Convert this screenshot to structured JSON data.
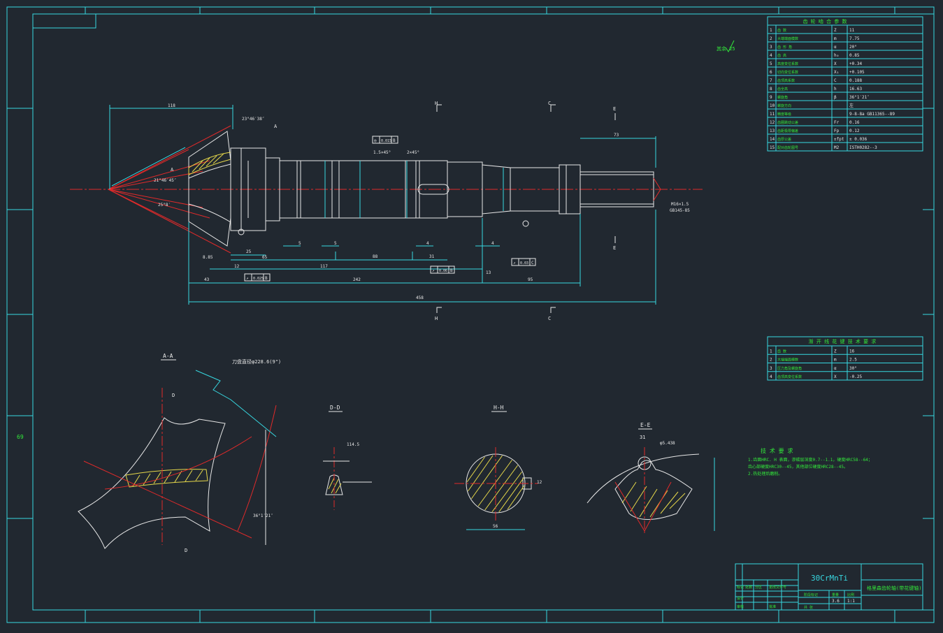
{
  "sheet": {
    "left_margin_number": "69"
  },
  "material": "30CrMnTi",
  "title_block": {
    "drawing_title": "格里森齿轮轴(带花键轴)",
    "cells": [
      "标记",
      "处数",
      "分区",
      "更改文件号",
      "签名",
      "年月日",
      "设计",
      "标准化",
      "审核",
      "工艺",
      "批准",
      "阶段标记",
      "重量",
      "比例",
      "共",
      "张",
      "第",
      "张"
    ],
    "scale": "1:1",
    "weight": "3.6",
    "sheets": "共 张"
  },
  "param_table": {
    "title": "齿 轮 啮 合 参 数",
    "rows": [
      {
        "no": "1",
        "name": "齿 数",
        "sym": "Z",
        "val": "11"
      },
      {
        "no": "2",
        "name": "大端端面模数",
        "sym": "m",
        "val": "7.75"
      },
      {
        "no": "3",
        "name": "齿 形 角",
        "sym": "α",
        "val": "20°"
      },
      {
        "no": "4",
        "name": "齿 高",
        "sym": "h₀",
        "val": "0.85"
      },
      {
        "no": "5",
        "name": "高度变位系数",
        "sym": "X",
        "val": "+0.34"
      },
      {
        "no": "6",
        "name": "切向变位系数",
        "sym": "X₁",
        "val": "+0.105"
      },
      {
        "no": "7",
        "name": "齿顶高系数",
        "sym": "C",
        "val": "0.188"
      },
      {
        "no": "8",
        "name": "齿全高",
        "sym": "h",
        "val": "16.63"
      },
      {
        "no": "9",
        "name": "螺旋角",
        "sym": "β",
        "val": "36°1′21″"
      },
      {
        "no": "10",
        "name": "螺旋方向",
        "sym": "",
        "val": "左"
      },
      {
        "no": "11",
        "name": "精度等级",
        "sym": "",
        "val": "9-8-8a GB11365--89"
      },
      {
        "no": "12",
        "name": "齿圈跳动公差",
        "sym": "Fr",
        "val": "0.16"
      },
      {
        "no": "13",
        "name": "齿距极限偏差",
        "sym": "Fp",
        "val": "0.12"
      },
      {
        "no": "14",
        "name": "齿厚公差",
        "sym": "±fpt",
        "val": "± 0.036"
      },
      {
        "no": "15",
        "name": "配对齿轮图号",
        "sym": "M2",
        "val": "ISTH0282--3"
      }
    ]
  },
  "spline_table": {
    "title": "渐 开 线 花 键 技 术 要 求",
    "rows": [
      {
        "no": "1",
        "name": "齿 数",
        "sym": "Z",
        "val": "16"
      },
      {
        "no": "2",
        "name": "大端端面模数",
        "sym": "m",
        "val": "2.5"
      },
      {
        "no": "3",
        "name": "压力角及螺旋角",
        "sym": "α",
        "val": "30°"
      },
      {
        "no": "4",
        "name": "齿顶高变位系数",
        "sym": "X",
        "val": "-0.25"
      }
    ]
  },
  "technical_requirements": {
    "title": "技 术 要 求",
    "lines": [
      "1.齿面HRC. H 表面，渗碳层深度0.7--1.1，硬度HRC58--64；",
      "   齿心部硬度HRC30--45，其他部位硬度HRC28--45。",
      "2.热处理后磨削。"
    ]
  },
  "roughness_note": "其余 25",
  "section_labels": {
    "aa": "A-A",
    "dd": "D-D",
    "hh": "H-H",
    "ee": "E-E",
    "h_top": "H",
    "h_bot": "H",
    "c_top": "C",
    "c_bot": "C",
    "e_top": "E",
    "e_bot": "E",
    "a1": "A",
    "a2": "A",
    "d_top": "D",
    "d_bot": "D"
  },
  "dimensions": {
    "d118": "118",
    "d73": "73",
    "d25": "25",
    "d65": "65",
    "d5a": "5",
    "d5b": "5",
    "d4a": "4",
    "d4b": "4",
    "d31": "31",
    "d88": "88",
    "d117": "117",
    "d43": "43",
    "d242": "242",
    "d95": "95",
    "d13": "13",
    "d12": "12",
    "d458": "458",
    "d885": "8.85",
    "total": "458",
    "m16": "M16×1.5",
    "gb": "GB145-85",
    "cham1": "2×45°",
    "cham2": "1.5×45°",
    "cut_dia": "刀盘直径φ228.6(9\")",
    "ang": "36°1′21″",
    "ang2": "23°46′38″",
    "ang3": "21°46′45″",
    "ang4": "25°8′",
    "d56": "56",
    "ee_31": "31",
    "ee_phi": "φ5.438",
    "dd_dim": "114.5",
    "hh_key": "12"
  },
  "tolerance_frames": [
    {
      "sym": "◎",
      "val": "0.015",
      "ref": "B"
    },
    {
      "sym": "↗",
      "val": "0.025",
      "ref": "B"
    },
    {
      "sym": "↗",
      "val": "0.06",
      "ref": "B"
    },
    {
      "sym": "↗",
      "val": "0.03",
      "ref": "C"
    }
  ]
}
